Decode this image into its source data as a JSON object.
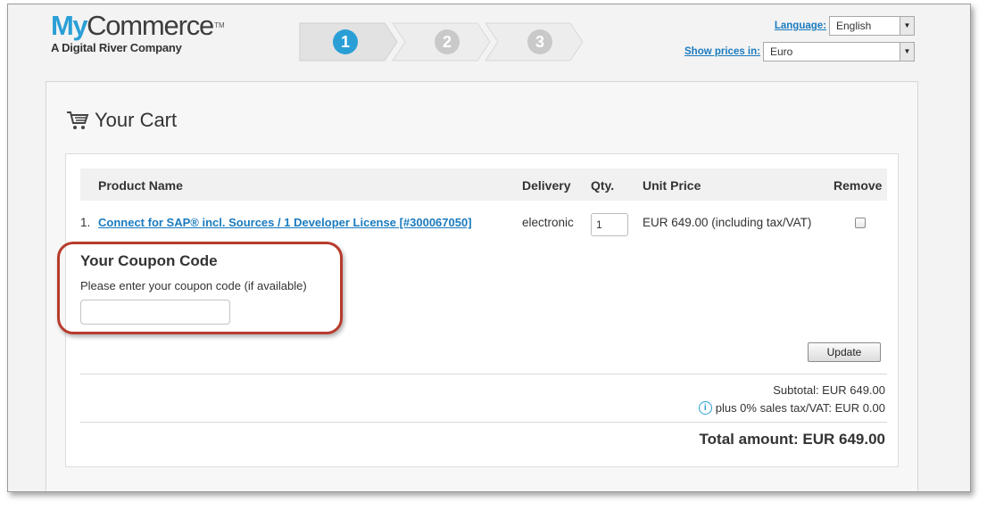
{
  "logo": {
    "brand_my": "My",
    "brand_commerce": "Commerce",
    "tm": "TM",
    "tagline": "A Digital River Company"
  },
  "steps": [
    {
      "number": "1",
      "state": "active"
    },
    {
      "number": "2",
      "state": "inactive"
    },
    {
      "number": "3",
      "state": "inactive"
    }
  ],
  "language": {
    "label": "Language:",
    "value": "English"
  },
  "currency": {
    "label": "Show prices in:",
    "value": "Euro"
  },
  "cart": {
    "title": "Your Cart",
    "columns": [
      "Product Name",
      "Delivery",
      "Qty.",
      "Unit Price",
      "Remove"
    ],
    "items": [
      {
        "index": "1.",
        "name": "Connect for SAP® incl. Sources / 1 Developer License [#300067050]",
        "delivery": "electronic",
        "qty": "1",
        "unit_price": "EUR 649.00 (including tax/VAT)",
        "remove_checked": false
      }
    ]
  },
  "coupon": {
    "title": "Your Coupon Code",
    "description": "Please enter your coupon code (if available)",
    "value": ""
  },
  "update_label": "Update",
  "totals": {
    "subtotal": "Subtotal: EUR 649.00",
    "tax": "plus 0% sales tax/VAT: EUR 0.00",
    "total": "Total amount: EUR 649.00"
  },
  "colors": {
    "accent": "#2a9fd6",
    "link": "#1a7bbf",
    "highlight_ring": "#b73b2c"
  }
}
